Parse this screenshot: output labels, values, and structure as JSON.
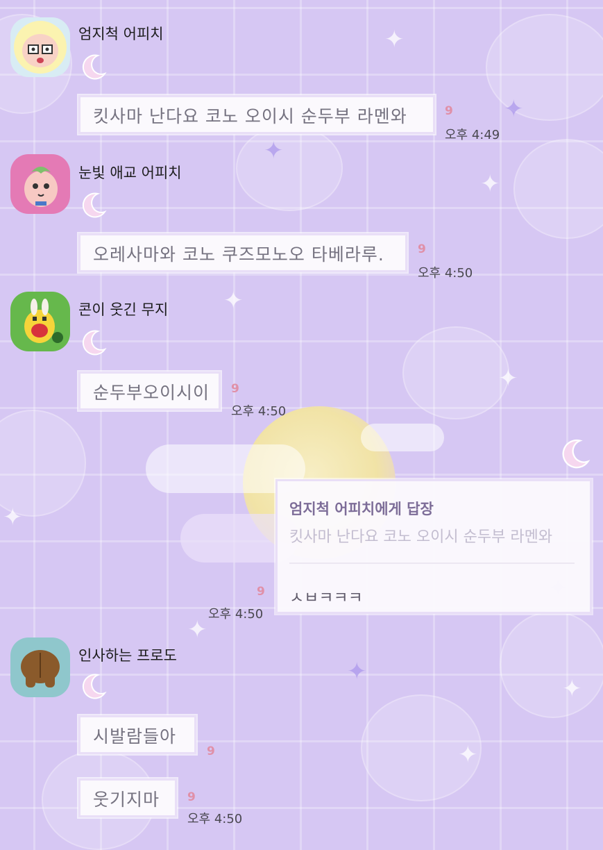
{
  "messages": [
    {
      "sender": "엄지척 어피치",
      "text": "킷사마 난다요 코노 오이시 순두부 라멘와",
      "unread": "9",
      "time": "오후 4:49"
    },
    {
      "sender": "눈빛 애교 어피치",
      "text": "오레사마와 코노 쿠즈모노오 타베라루.",
      "unread": "9",
      "time": "오후 4:50"
    },
    {
      "sender": "콘이 웃긴 무지",
      "text": "순두부오이시이",
      "unread": "9",
      "time": "오후 4:50"
    },
    {
      "reply_title": "엄지척 어피치에게 답장",
      "reply_quote": "킷사마 난다요 코노 오이시 순두부 라멘와",
      "text": "ㅅㅂㅋㅋㅋ",
      "unread": "9",
      "time": "오후 4:50"
    },
    {
      "sender": "인사하는 프로도",
      "text": "시발람들아",
      "unread": "9"
    },
    {
      "text": "웃기지마",
      "unread": "9",
      "time": "오후 4:50"
    }
  ],
  "colors": {
    "background": "#d6c7f3",
    "bubble": "#fbf9fd",
    "unread": "#e090a8",
    "moon_icon": "#f6d7ef"
  }
}
